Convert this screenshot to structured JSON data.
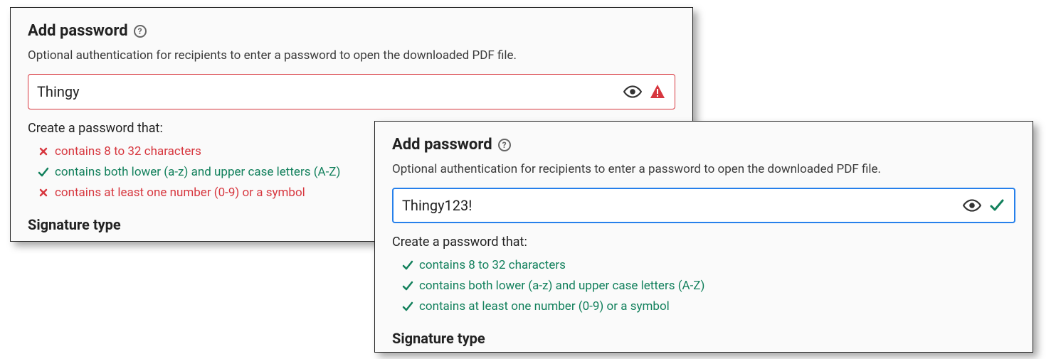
{
  "panel1": {
    "title": "Add password",
    "description": "Optional authentication for recipients to enter a password to open the downloaded PDF file.",
    "input_value": "Thingy",
    "criteria_title": "Create a password that:",
    "criteria": [
      {
        "label": "contains 8 to 32 characters",
        "pass": false
      },
      {
        "label": "contains both lower (a-z) and upper case letters (A-Z)",
        "pass": true
      },
      {
        "label": "contains at least one number (0-9) or a symbol",
        "pass": false
      }
    ],
    "signature_title": "Signature type"
  },
  "panel2": {
    "title": "Add password",
    "description": "Optional authentication for recipients to enter a password to open the downloaded PDF file.",
    "input_value": "Thingy123!",
    "criteria_title": "Create a password that:",
    "criteria": [
      {
        "label": "contains 8 to 32 characters",
        "pass": true
      },
      {
        "label": "contains both lower (a-z) and upper case letters (A-Z)",
        "pass": true
      },
      {
        "label": "contains at least one number (0-9) or a symbol",
        "pass": true
      }
    ],
    "signature_title": "Signature type"
  },
  "colors": {
    "error": "#d7373f",
    "success": "#12805c",
    "focus": "#2680eb"
  }
}
